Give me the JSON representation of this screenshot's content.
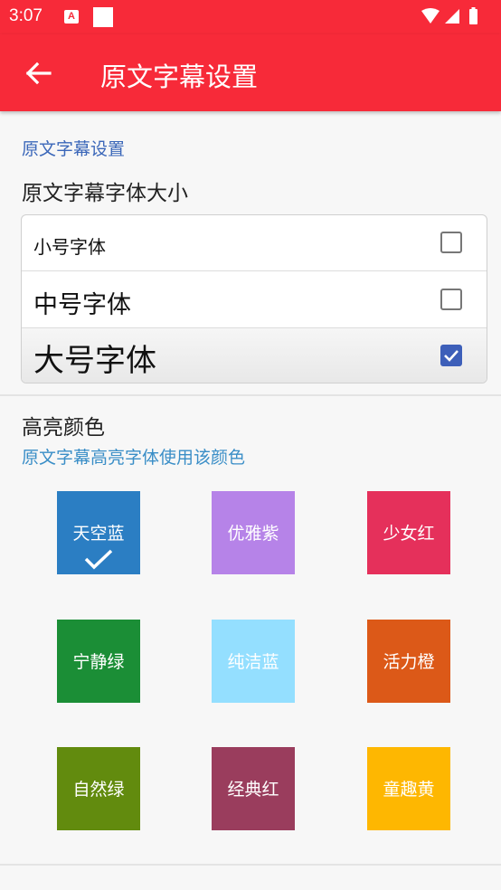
{
  "status_bar": {
    "time": "3:07",
    "notification_icon": "A"
  },
  "app_bar": {
    "title": "原文字幕设置"
  },
  "section_title": "原文字幕设置",
  "font_size": {
    "label": "原文字幕字体大小",
    "options": [
      {
        "label": "小号字体",
        "checked": false
      },
      {
        "label": "中号字体",
        "checked": false
      },
      {
        "label": "大号字体",
        "checked": true
      }
    ]
  },
  "highlight": {
    "label": "高亮颜色",
    "description": "原文字幕高亮字体使用该颜色",
    "colors": [
      {
        "name": "天空蓝",
        "color": "#2b7ec3",
        "selected": true
      },
      {
        "name": "优雅紫",
        "color": "#b683e8",
        "selected": false
      },
      {
        "name": "少女红",
        "color": "#e5305b",
        "selected": false
      },
      {
        "name": "宁静绿",
        "color": "#1b8e36",
        "selected": false
      },
      {
        "name": "纯洁蓝",
        "color": "#94dfff",
        "selected": false
      },
      {
        "name": "活力橙",
        "color": "#dc5918",
        "selected": false
      },
      {
        "name": "自然绿",
        "color": "#628b0e",
        "selected": false
      },
      {
        "name": "经典红",
        "color": "#9a3d5d",
        "selected": false
      },
      {
        "name": "童趣黄",
        "color": "#feb701",
        "selected": false
      }
    ]
  }
}
